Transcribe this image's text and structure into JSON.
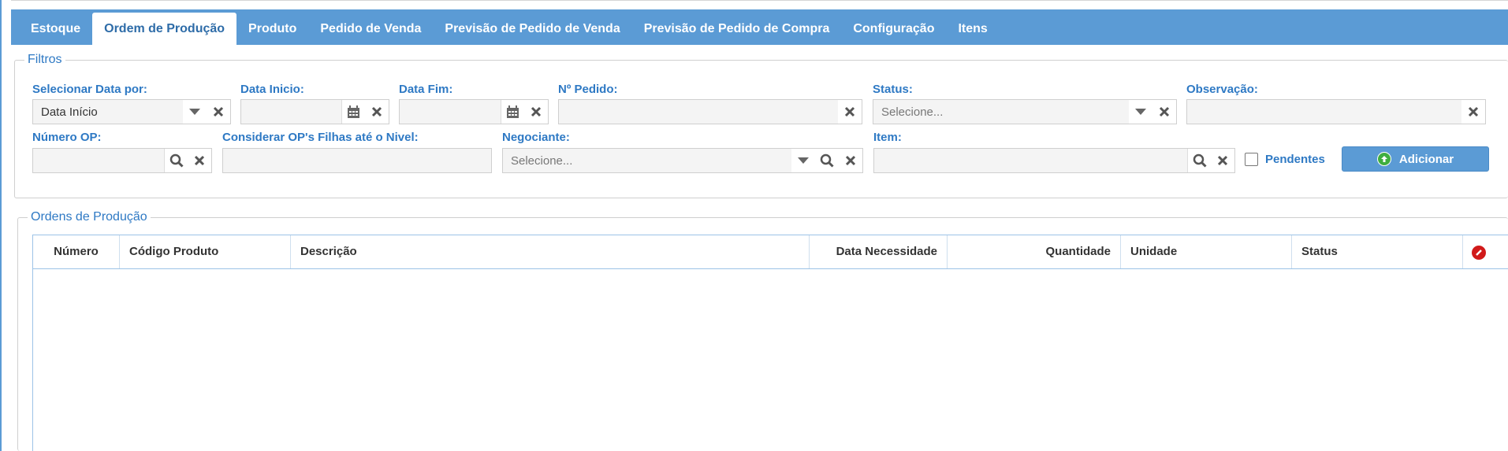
{
  "tabs": [
    {
      "label": "Estoque",
      "active": false
    },
    {
      "label": "Ordem de Produção",
      "active": true
    },
    {
      "label": "Produto",
      "active": false
    },
    {
      "label": "Pedido de Venda",
      "active": false
    },
    {
      "label": "Previsão de Pedido de Venda",
      "active": false
    },
    {
      "label": "Previsão de Pedido de Compra",
      "active": false
    },
    {
      "label": "Configuração",
      "active": false
    },
    {
      "label": "Itens",
      "active": false
    }
  ],
  "filters": {
    "legend": "Filtros",
    "select_date_by": {
      "label": "Selecionar Data por:",
      "value": "Data Início"
    },
    "start_date": {
      "label": "Data Inicio:",
      "value": ""
    },
    "end_date": {
      "label": "Data Fim:",
      "value": ""
    },
    "order_number": {
      "label": "Nº Pedido:",
      "value": ""
    },
    "status": {
      "label": "Status:",
      "placeholder": "Selecione..."
    },
    "observation": {
      "label": "Observação:",
      "value": ""
    },
    "op_number": {
      "label": "Número OP:",
      "value": ""
    },
    "child_op_level": {
      "label": "Considerar OP's Filhas até o Nivel:",
      "value": ""
    },
    "negotiator": {
      "label": "Negociante:",
      "placeholder": "Selecione..."
    },
    "item": {
      "label": "Item:",
      "value": ""
    },
    "pending": {
      "label": "Pendentes",
      "checked": false
    },
    "add_button": {
      "label": "Adicionar"
    }
  },
  "orders": {
    "legend": "Ordens de Produção",
    "columns": [
      "Número",
      "Código Produto",
      "Descrição",
      "Data Necessidade",
      "Quantidade",
      "Unidade",
      "Status"
    ],
    "rows": []
  },
  "colors": {
    "accent": "#5b9bd5",
    "label": "#2e79c4",
    "add_icon": "#3fae3f",
    "clear_icon": "#d11a1a"
  }
}
